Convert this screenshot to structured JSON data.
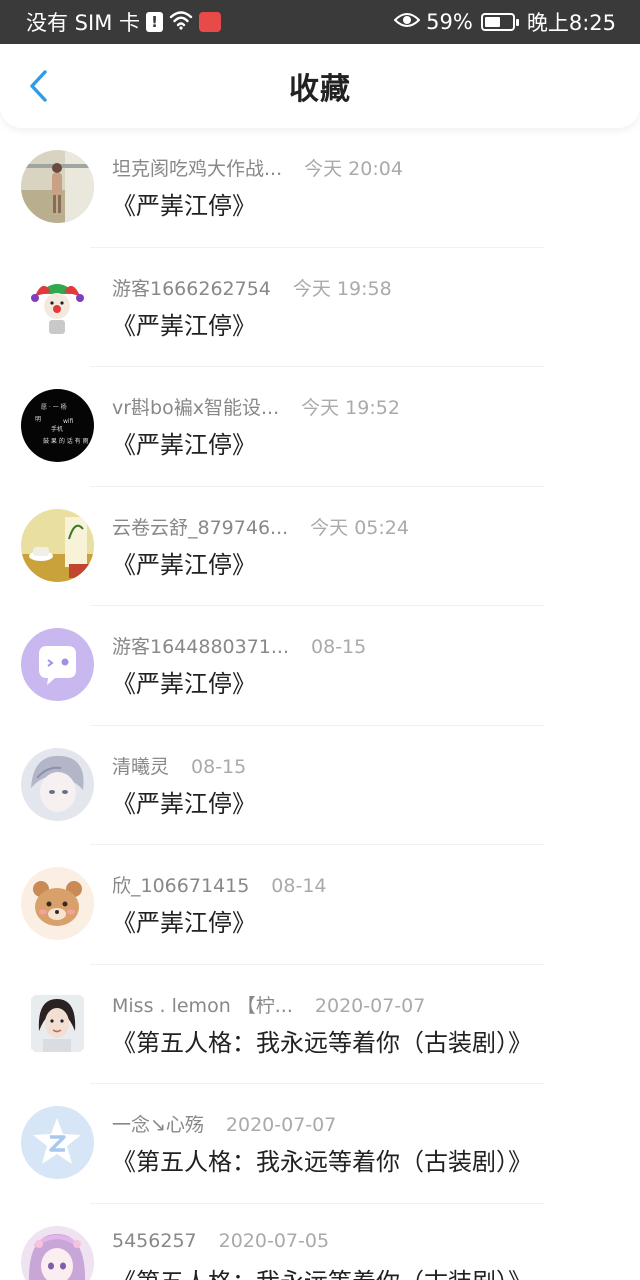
{
  "status_bar": {
    "carrier": "没有 SIM 卡",
    "sim_badge": "!",
    "battery_percent": "59%",
    "battery_level": 0.59,
    "time": "晚上8:25"
  },
  "header": {
    "title": "收藏"
  },
  "favorites": [
    {
      "user": "坦克阂吃鸡大作战...",
      "time": "今天 20:04",
      "title": "《严㟖江停》",
      "avatar": "photo-avatar-outdoor"
    },
    {
      "user": "游客1666262754",
      "time": "今天 19:58",
      "title": "《严㟖江停》",
      "avatar": "clown-avatar"
    },
    {
      "user": "vr斟bo褊x智能设...",
      "time": "今天 19:52",
      "title": "《严㟖江停》",
      "avatar": "black-text-avatar"
    },
    {
      "user": "云卷云舒_879746...",
      "time": "今天 05:24",
      "title": "《严㟖江停》",
      "avatar": "tea-scene-avatar"
    },
    {
      "user": "游客1644880371...",
      "time": "08-15",
      "title": "《严㟖江停》",
      "avatar": "chat-bubble-avatar"
    },
    {
      "user": "清曦灵",
      "time": "08-15",
      "title": "《严㟖江停》",
      "avatar": "anime-boy-avatar"
    },
    {
      "user": "欣_106671415",
      "time": "08-14",
      "title": "《严㟖江停》",
      "avatar": "bear-avatar"
    },
    {
      "user": "Miss . lemon 【柠...",
      "time": "2020-07-07",
      "title": "《第五人格：我永远等着你（古装剧）》",
      "avatar": "girl-photo-avatar"
    },
    {
      "user": "一念↘心殇",
      "time": "2020-07-07",
      "title": "《第五人格：我永远等着你（古装剧）》",
      "avatar": "default-z-avatar"
    },
    {
      "user": "5456257",
      "time": "2020-07-05",
      "title": "《第五人格：我永远等着你（古装剧）》",
      "avatar": "anime-girl-avatar"
    }
  ],
  "colors": {
    "status_bar_bg": "#3a3a3a",
    "back_arrow": "#2f9be8",
    "username": "#888888",
    "timestamp": "#aaaaaa"
  }
}
